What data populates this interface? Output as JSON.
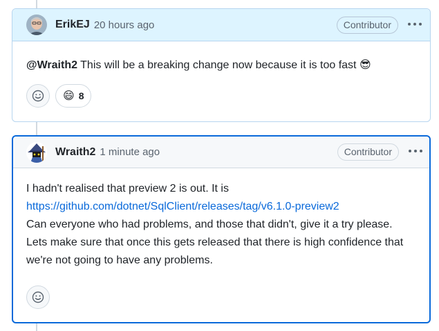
{
  "comments": [
    {
      "author": "ErikEJ",
      "time": "20 hours ago",
      "badge": "Contributor",
      "mention": "@Wraith2",
      "body_text": " This will be a breaking change now because it is too fast",
      "body_emoji": "😎",
      "reactions": [
        {
          "emoji": "😄",
          "count": "8"
        }
      ]
    },
    {
      "author": "Wraith2",
      "time": "1 minute ago",
      "badge": "Contributor",
      "body_line1": "I hadn't realised that preview 2 is out. It is",
      "link": "https://github.com/dotnet/SqlClient/releases/tag/v6.1.0-preview2",
      "body_rest": "Can everyone who had problems, and those that didn't, give it a try please. Lets make sure that once this gets released that there is high confidence that we're not going to have any problems."
    }
  ],
  "icons": {
    "add_reaction": "smiley-icon",
    "more": "kebab-horizontal-icon"
  },
  "colors": {
    "link": "#0969da",
    "focus_border": "#0969da",
    "author_header_bg": "#ddf4ff"
  }
}
